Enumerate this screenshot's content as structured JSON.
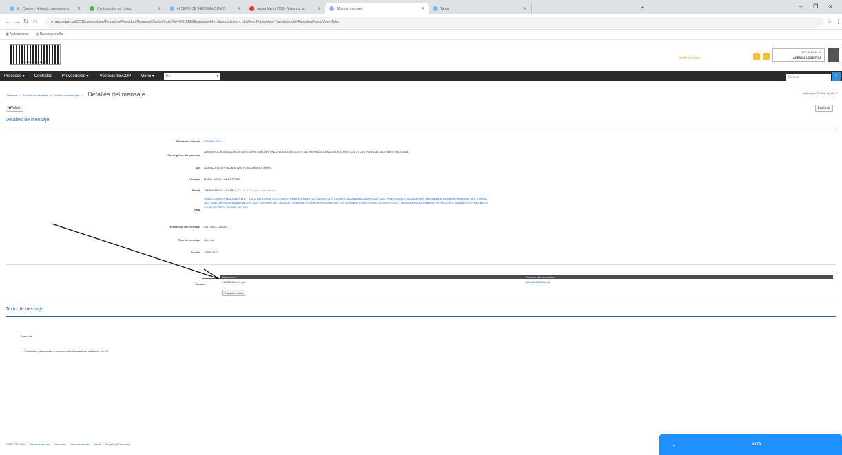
{
  "browser": {
    "tabs": [
      {
        "label": "E - Correo - N Ágata planeamiento"
      },
      {
        "label": "Contratación en Línea"
      },
      {
        "label": "el CERO DE INFORMACIÓN D"
      },
      {
        "label": "Agata Merlo VIBE - Vigencia la"
      },
      {
        "label": "Mostrar mensaje"
      },
      {
        "label": "Tarea"
      }
    ],
    "url_host": "secop.gov.co",
    "url_path": "/CO1BusinessLine/Tendering/ProcedureMessage/Display/Index?id=CO1MSG&messageId=...&procedureId=...&isFromPublicArea=True&isModal=False&asPopupView=false",
    "bookmarks": [
      "Aplicaciones",
      "Nuevo pestaña"
    ]
  },
  "header": {
    "logo_text": "Colombia Compra Eficiente",
    "notification": "Notificaciones",
    "user_line1": "UTC -5 13:42:18",
    "user_line2": "AGENCIA LOGISTICA"
  },
  "menu": {
    "items": [
      "Procesos",
      "Contratos",
      "Proveedores",
      "Procesos SECOP",
      "Menú"
    ],
    "select_value": "0.4",
    "search_placeholder": "Buscar"
  },
  "breadcrumb": {
    "items": [
      "Gerencia",
      "Gestión de mensajes",
      "Gestión de mensajes"
    ],
    "current": "Detalles del mensaje"
  },
  "topright": {
    "prefix": "Ir al objeto",
    "link": "TOD0D",
    "help": "Ayuda"
  },
  "buttons": {
    "back": "Volver",
    "print": "Imprimir"
  },
  "details": {
    "section_title": "Detalles de mensaje",
    "rows": [
      {
        "label": "Referencia interna",
        "value": "018-009-2019"
      },
      {
        "label": "Descripción del proceso",
        "value": "ADQUISICIÓN DE EQUIPOS DE COCINA CON DESTINO A LOS COMEDORES DE TROPA DE LA AGENCIA LOGISTICA DE LAS FUERZAS MILITARES REGIONAL"
      },
      {
        "label": "De",
        "value": "AGENCIA LOGISTICA DE LAS FUERZAS MILITARES"
      },
      {
        "label": "Usuario",
        "value": "MARIA SOFIA LOPEZ DORIA"
      },
      {
        "label": "Fecha",
        "value": "18/06/2019 12:14:54 PM",
        "hint": "(UTC-05:00 Bogotá, Lima, Quito)"
      },
      {
        "label": "Para",
        "value": "SOLUCIONES INTEGRALES B & T S.A.S; IB GLOBAL S.A.S; INDUSTRIAS FORMAS SA; OMNIA S.A.S; COMERCIALIZADORA NAVAR LAR SAS; INVERSIONES SILICATA SAS; Manufacturas Lamberts Technology SAS; FORGA SAS; ERECTRONICS & INNOVACIÓN LUCI GUSTAVE DE CALLADIT; LABORALEG; MEGAGRANDIA LTDA; DOTACIONES Y ASESORIAS CALVARIT S.A.S.; OBSTACERIA LA CABAÑA; SERVICIOS Y SUMINISTROS DEL META S.A.S; CONTROL GROUP ME SAS"
      },
      {
        "label": "Referencia del mensaje",
        "value": "CO1.MSG.1006417"
      },
      {
        "label": "Tipo de mensaje",
        "value": "General"
      },
      {
        "label": "Asunto",
        "value": "ADENDA 01"
      }
    ]
  },
  "annexes": {
    "label": "Anexos",
    "headers": [
      "Documento",
      "Nombre del documento"
    ],
    "rows": [
      {
        "document": "01 ADENDA 01.pdf",
        "name": "01 ADENDA 01.pdf"
      }
    ],
    "export_button": "Exportar todos"
  },
  "message": {
    "section_title": "Texto de mensaje",
    "greeting": "Buen día,",
    "body": "La Entidad se permite dar a conocer a los interesados la Adenda No. 01"
  },
  "footer": {
    "copyright": "© SECOP 2019",
    "links": [
      "Términos de uso",
      "Normativa",
      "Soporte técnico",
      "Ayuda",
      "Español (Colombia)"
    ]
  },
  "chat": {
    "title": "IOTA"
  },
  "colors": {
    "menu_bg": "#2b2b2b",
    "link": "#1a66cc",
    "section": "#2e6da4",
    "chat": "#1e90ff"
  }
}
